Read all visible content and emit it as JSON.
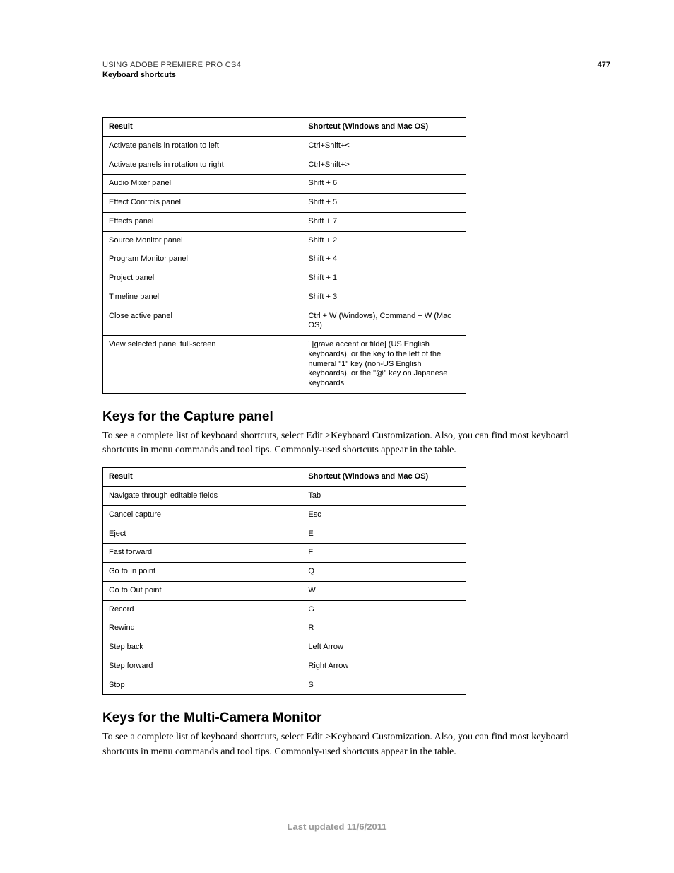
{
  "header": {
    "line1": "USING ADOBE PREMIERE PRO CS4",
    "line2": "Keyboard shortcuts",
    "page_number": "477"
  },
  "table1": {
    "headers": {
      "result": "Result",
      "shortcut": "Shortcut (Windows and Mac OS)"
    },
    "rows": [
      {
        "result": "Activate panels in rotation to left",
        "shortcut": "Ctrl+Shift+<"
      },
      {
        "result": "Activate panels in rotation to right",
        "shortcut": "Ctrl+Shift+>"
      },
      {
        "result": "Audio Mixer panel",
        "shortcut": "Shift + 6"
      },
      {
        "result": "Effect Controls panel",
        "shortcut": "Shift + 5"
      },
      {
        "result": "Effects panel",
        "shortcut": "Shift + 7"
      },
      {
        "result": "Source Monitor panel",
        "shortcut": "Shift + 2"
      },
      {
        "result": "Program Monitor panel",
        "shortcut": "Shift + 4"
      },
      {
        "result": "Project panel",
        "shortcut": "Shift + 1"
      },
      {
        "result": "Timeline panel",
        "shortcut": "Shift + 3"
      },
      {
        "result": "Close active panel",
        "shortcut": "Ctrl + W (Windows), Command + W (Mac OS)"
      },
      {
        "result": "View selected panel full-screen",
        "shortcut": "' [grave accent or tilde] (US English keyboards), or the key to the left of the numeral \"1\" key (non-US English keyboards), or the \"@\" key on Japanese keyboards"
      }
    ]
  },
  "section_capture": {
    "heading": "Keys for the Capture panel",
    "intro": "To see a complete list of keyboard shortcuts, select Edit >Keyboard Customization. Also, you can find most keyboard shortcuts in menu commands and tool tips. Commonly-used shortcuts appear in the table."
  },
  "table2": {
    "headers": {
      "result": "Result",
      "shortcut": "Shortcut (Windows and Mac OS)"
    },
    "rows": [
      {
        "result": "Navigate through editable fields",
        "shortcut": "Tab"
      },
      {
        "result": "Cancel capture",
        "shortcut": "Esc"
      },
      {
        "result": "Eject",
        "shortcut": "E"
      },
      {
        "result": "Fast forward",
        "shortcut": "F"
      },
      {
        "result": "Go to In point",
        "shortcut": "Q"
      },
      {
        "result": "Go to Out point",
        "shortcut": "W"
      },
      {
        "result": "Record",
        "shortcut": "G"
      },
      {
        "result": "Rewind",
        "shortcut": "R"
      },
      {
        "result": "Step back",
        "shortcut": "Left Arrow"
      },
      {
        "result": "Step forward",
        "shortcut": "Right Arrow"
      },
      {
        "result": "Stop",
        "shortcut": "S"
      }
    ]
  },
  "section_multicam": {
    "heading": "Keys for the Multi-Camera Monitor",
    "intro": "To see a complete list of keyboard shortcuts, select Edit >Keyboard Customization. Also, you can find most keyboard shortcuts in menu commands and tool tips. Commonly-used shortcuts appear in the table."
  },
  "footer": {
    "text": "Last updated 11/6/2011"
  }
}
